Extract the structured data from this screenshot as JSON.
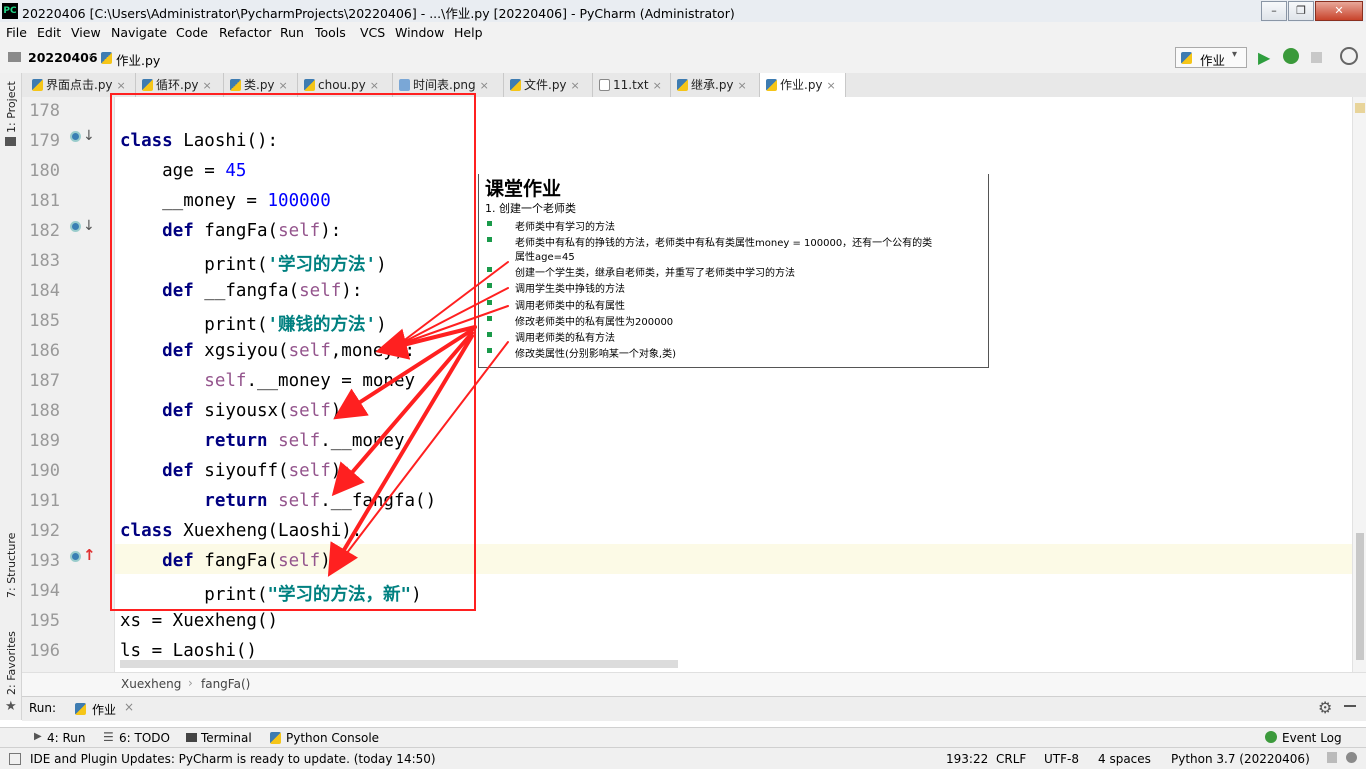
{
  "window": {
    "title": "20220406 [C:\\Users\\Administrator\\PycharmProjects\\20220406] - ...\\作业.py [20220406] - PyCharm (Administrator)",
    "app_icon": "PC",
    "controls": {
      "minimize": "–",
      "restore": "❐",
      "close": "✕"
    }
  },
  "menu": [
    "File",
    "Edit",
    "View",
    "Navigate",
    "Code",
    "Refactor",
    "Run",
    "Tools",
    "VCS",
    "Window",
    "Help"
  ],
  "nav": {
    "project": "20220406",
    "file": "作业.py",
    "run_config": "作业"
  },
  "tabs": [
    "界面点击.py",
    "循环.py",
    "类.py",
    "chou.py",
    "时间表.png",
    "文件.py",
    "11.txt",
    "继承.py",
    "作业.py"
  ],
  "side_panels": {
    "project": "1: Project",
    "structure": "7: Structure",
    "favorites": "2: Favorites"
  },
  "code": {
    "line_numbers": [
      "178",
      "179",
      "180",
      "181",
      "182",
      "183",
      "184",
      "185",
      "186",
      "187",
      "188",
      "189",
      "190",
      "191",
      "192",
      "193",
      "194",
      "195",
      "196"
    ],
    "l179": {
      "kw": "class",
      "rest": " Laoshi():"
    },
    "l180": {
      "a": "    age = ",
      "num": "45"
    },
    "l181": {
      "a": "    __money = ",
      "num": "100000"
    },
    "l182": {
      "kw": "def",
      "a": " fangFa(",
      "self": "self",
      "b": "):"
    },
    "l183": {
      "a": "        print(",
      "str": "'学习的方法'",
      "b": ")"
    },
    "l184": {
      "kw": "def",
      "a": " __fangfa(",
      "self": "self",
      "b": "):"
    },
    "l185": {
      "a": "        print(",
      "str": "'赚钱的方法'",
      "b": ")"
    },
    "l186": {
      "kw": "def",
      "a": " xgsiyou(",
      "self": "self",
      "b": ",money):"
    },
    "l187": {
      "self": "self",
      "a": ".__money = money"
    },
    "l188": {
      "kw": "def",
      "a": " siyousx(",
      "self": "self",
      "b": "):"
    },
    "l189": {
      "kw": "return",
      "self": "self",
      "a": ".__money"
    },
    "l190": {
      "kw": "def",
      "a": " siyouff(",
      "self": "self",
      "b": "):"
    },
    "l191": {
      "kw": "return",
      "self": "self",
      "a": ".__fangfa()"
    },
    "l192": {
      "kw": "class",
      "rest": " Xuexheng(Laoshi):"
    },
    "l193": {
      "kw": "def",
      "a": " fangFa(",
      "self": "self",
      "b": "):"
    },
    "l194": {
      "a": "        print(",
      "str": "\"学习的方法，新\"",
      "b": ")"
    },
    "l195": {
      "a": "xs = Xuexheng()"
    },
    "l196": {
      "a": "ls = Laoshi()"
    }
  },
  "homework": {
    "title": "课堂作业",
    "subtitle": "1. 创建一个老师类",
    "items": [
      "老师类中有学习的方法",
      "老师类中有私有的挣钱的方法，老师类中有私有类属性money  = 100000，还有一个公有的类",
      "属性age=45",
      "创建一个学生类，继承自老师类，并重写了老师类中学习的方法",
      "调用学生类中挣钱的方法",
      "调用老师类中的私有属性",
      "修改老师类中的私有属性为200000",
      "调用老师类的私有方法",
      "修改类属性(分别影响某一个对象,类)"
    ]
  },
  "breadcrumb": [
    "Xuexheng",
    "fangFa()"
  ],
  "run": {
    "label": "Run:",
    "tab": "作业"
  },
  "toolwindows": [
    "4: Run",
    "6: TODO",
    "Terminal",
    "Python Console"
  ],
  "event_log": "Event Log",
  "status": {
    "message": "IDE and Plugin Updates: PyCharm is ready to update. (today 14:50)",
    "position": "193:22",
    "line_sep": "CRLF",
    "encoding": "UTF-8",
    "indent": "4 spaces",
    "interpreter": "Python 3.7 (20220406)"
  },
  "colors": {
    "annotation": "#ff2020",
    "keyword": "#000080",
    "string": "#008080",
    "self": "#94558d",
    "number": "#0000ff"
  }
}
